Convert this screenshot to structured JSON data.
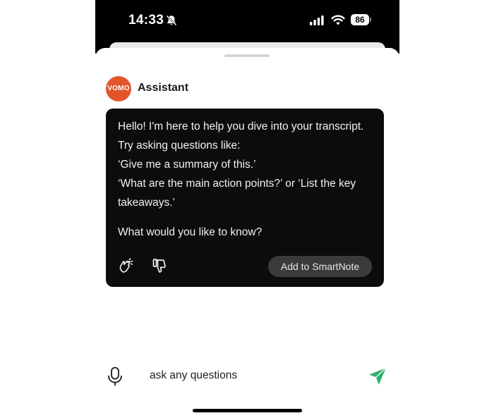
{
  "status_bar": {
    "time": "14:33",
    "battery_level": "86",
    "icons": [
      "bell-slash-icon",
      "signal-icon",
      "wifi-icon",
      "battery-icon"
    ]
  },
  "header": {
    "avatar_text": "VOMO",
    "title": "Assistant"
  },
  "message": {
    "lines": [
      "Hello! I'm here to help you dive into your transcript. Try asking questions like:",
      "‘Give me a summary of this.’",
      "‘What are the main action points?’ or ‘List the key takeaways.’",
      "What would you like to know?"
    ],
    "action_button": "Add to SmartNote",
    "icons": [
      "clap-icon",
      "thumbs-down-icon"
    ]
  },
  "composer": {
    "placeholder": "ask any questions",
    "value": "",
    "icons": [
      "microphone-icon",
      "send-icon"
    ]
  },
  "colors": {
    "brand": "#e2552a",
    "bubble_bg": "#0c0c0e",
    "send_accent": "#2fb070",
    "chip_bg": "#3b3b3d"
  }
}
